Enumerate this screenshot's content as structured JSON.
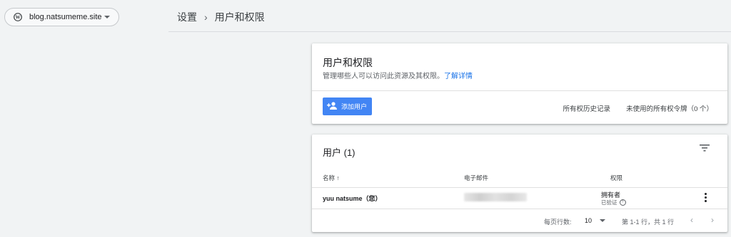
{
  "site": {
    "name": "blog.natsumeme.site"
  },
  "breadcrumb": {
    "settings": "设置",
    "sep": "›",
    "current": "用户和权限"
  },
  "users_card": {
    "title": "用户和权限",
    "subtitle": "管理哪些人可以访问此资源及其权限。",
    "learn_more": "了解详情",
    "add_user": "添加用户",
    "ownership_history": "所有权历史记录",
    "unused_tokens": "未使用的所有权令牌（0 个）"
  },
  "list_card": {
    "title": "用户 (1)",
    "columns": {
      "name": "名称",
      "sort": "↑",
      "email": "电子邮件",
      "permission": "权限"
    },
    "rows": [
      {
        "name": "yuu natsume（您）",
        "email": "",
        "permission": "拥有者",
        "status": "已验证"
      }
    ],
    "pager": {
      "rows_label": "每页行数:",
      "rows_value": "10",
      "range": "第 1-1 行，共 1 行",
      "prev": "‹",
      "next": "›"
    }
  },
  "colors": {
    "accent": "#4285f4",
    "link": "#1a73e8"
  }
}
